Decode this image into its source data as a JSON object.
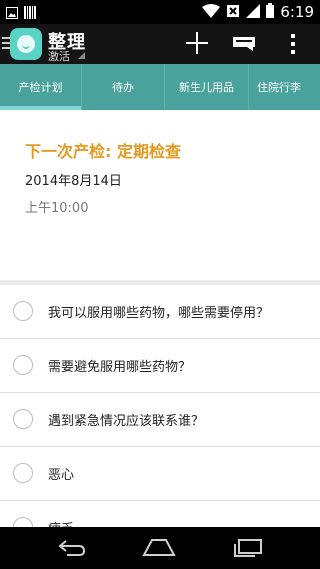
{
  "status_bar": {
    "time": "6:19",
    "icons": [
      "image-icon",
      "barcode-icon",
      "wifi-icon",
      "no-sim-icon",
      "signal-icon",
      "battery-icon"
    ]
  },
  "action_bar": {
    "title": "整理",
    "subtitle": "激活",
    "icons": [
      "drawer-icon",
      "app-logo-icon",
      "add-icon",
      "message-icon",
      "more-icon"
    ]
  },
  "tabs": [
    {
      "label": "产检计划",
      "active": true
    },
    {
      "label": "待办",
      "active": false
    },
    {
      "label": "新生儿用品",
      "active": false
    },
    {
      "label": "住院行李",
      "active": false
    }
  ],
  "appointment": {
    "title": "下一次产检: 定期检查",
    "date": "2014年8月14日",
    "time": "上午10:00"
  },
  "checklist": [
    {
      "text": "我可以服用哪些药物，哪些需要停用？"
    },
    {
      "text": "需要避免服用哪些药物？"
    },
    {
      "text": "遇到紧急情况应该联系谁？"
    },
    {
      "text": "恶心"
    },
    {
      "text": "疲乏"
    }
  ],
  "nav_bar": {
    "icons": [
      "back-icon",
      "home-icon",
      "recent-apps-icon"
    ]
  },
  "colors": {
    "accent": "#e39a22",
    "tab_bar": "#4aa29c",
    "tab_indicator": "#7fd8d1",
    "app_logo": "#59d3c6"
  }
}
